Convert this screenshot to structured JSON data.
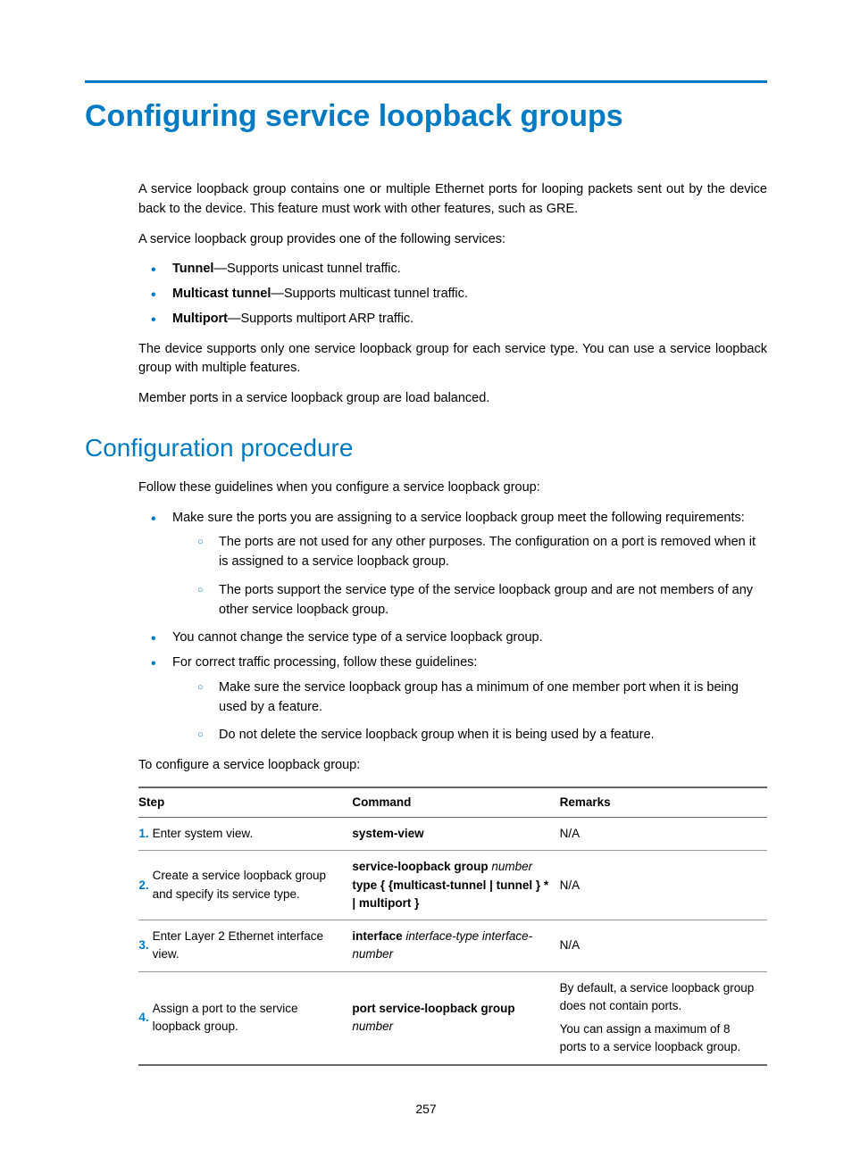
{
  "page_number": "257",
  "title": "Configuring service loopback groups",
  "intro_p1": "A service loopback group contains one or multiple Ethernet ports for looping packets sent out by the device back to the device. This feature must work with other features, such as GRE.",
  "intro_p2": "A service loopback group provides one of the following services:",
  "services": [
    {
      "term": "Tunnel",
      "desc": "—Supports unicast tunnel traffic."
    },
    {
      "term": "Multicast tunnel",
      "desc": "—Supports multicast tunnel traffic."
    },
    {
      "term": "Multiport",
      "desc": "—Supports multiport ARP traffic."
    }
  ],
  "intro_p3": "The device supports only one service loopback group for each service type. You can use a service loopback group with multiple features.",
  "intro_p4": "Member ports in a service loopback group are load balanced.",
  "section2_title": "Configuration procedure",
  "guidelines_intro": "Follow these guidelines when you configure a service loopback group:",
  "guidelines": {
    "g1": "Make sure the ports you are assigning to a service loopback group meet the following requirements:",
    "g1_sub": [
      "The ports are not used for any other purposes. The configuration on a port is removed when it is assigned to a service loopback group.",
      "The ports support the service type of the service loopback group and are not members of any other service loopback group."
    ],
    "g2": "You cannot change the service type of a service loopback group.",
    "g3": "For correct traffic processing, follow these guidelines:",
    "g3_sub": [
      "Make sure the service loopback group has a minimum of one member port when it is being used by a feature.",
      "Do not delete the service loopback group when it is being used by a feature."
    ]
  },
  "configure_intro": "To configure a service loopback group:",
  "table": {
    "headers": {
      "step": "Step",
      "command": "Command",
      "remarks": "Remarks"
    },
    "rows": [
      {
        "num": "1.",
        "step": "Enter system view.",
        "cmd_bold1": "system-view",
        "cmd_ital1": "",
        "cmd_bold2": "",
        "cmd_ital2": "",
        "remarks": "N/A"
      },
      {
        "num": "2.",
        "step": "Create a service loopback group and specify its service type.",
        "cmd_bold1": "service-loopback group ",
        "cmd_ital1": "number",
        "cmd_bold2": "type { {multicast-tunnel | tunnel } * | multiport }",
        "cmd_ital2": "",
        "remarks": "N/A"
      },
      {
        "num": "3.",
        "step": "Enter Layer 2 Ethernet interface view.",
        "cmd_bold1": "interface ",
        "cmd_ital1": "interface-type interface-number",
        "cmd_bold2": "",
        "cmd_ital2": "",
        "remarks": "N/A"
      },
      {
        "num": "4.",
        "step": "Assign a port to the service loopback group.",
        "cmd_bold1": "port service-loopback group ",
        "cmd_ital1": "number",
        "cmd_bold2": "",
        "cmd_ital2": "",
        "remarks_p1": "By default, a service loopback group does not contain ports.",
        "remarks_p2": "You can assign a maximum of 8 ports to a service loopback group."
      }
    ]
  }
}
